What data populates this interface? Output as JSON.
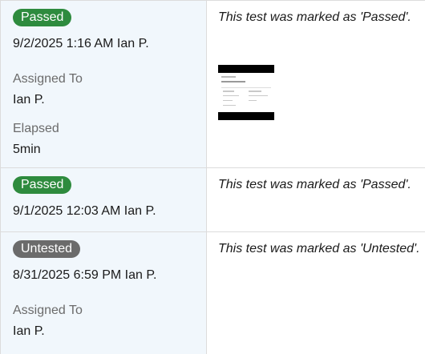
{
  "results": [
    {
      "status": "Passed",
      "timestamp": "9/2/2025 1:16 AM",
      "user": "Ian P.",
      "assigned_label": "Assigned To",
      "assigned_value": "Ian P.",
      "elapsed_label": "Elapsed",
      "elapsed_value": "5min",
      "comment": "This test was marked as 'Passed'.",
      "attachment_icon": "screenshot-thumbnail-icon"
    },
    {
      "status": "Passed",
      "timestamp": "9/1/2025 12:03 AM",
      "user": "Ian P.",
      "comment": "This test was marked as 'Passed'."
    },
    {
      "status": "Untested",
      "timestamp": "8/31/2025 6:59 PM",
      "user": "Ian P.",
      "assigned_label": "Assigned To",
      "assigned_value": "Ian P.",
      "comment": "This test was marked as 'Untested'."
    }
  ],
  "colors": {
    "passed": "#2e8b3e",
    "untested": "#6b6b6b",
    "panel": "#f1f7fc"
  }
}
